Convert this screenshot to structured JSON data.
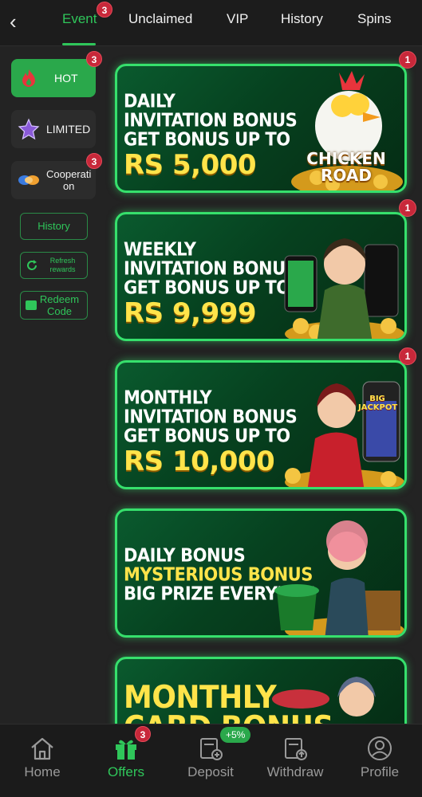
{
  "tabs": [
    {
      "label": "Event",
      "active": true,
      "badge": "3"
    },
    {
      "label": "Unclaimed"
    },
    {
      "label": "VIP"
    },
    {
      "label": "History"
    },
    {
      "label": "Spins"
    }
  ],
  "sidebar": {
    "items": [
      {
        "label": "HOT",
        "badge": "3",
        "icon": "flame-icon"
      },
      {
        "label": "LIMITED",
        "icon": "star-icon"
      },
      {
        "label": "Cooperati\non",
        "badge": "3",
        "icon": "handshake-icon"
      }
    ],
    "history_label": "History",
    "refresh_label": "Refresh\nrewards",
    "redeem_label": "Redeem\nCode"
  },
  "cards": [
    {
      "line1": "DAILY",
      "line2": "INVITATION BONUS",
      "line3": "GET BONUS UP TO",
      "amount": "RS 5,000",
      "badge": "1",
      "art_text": "CHICKEN ROAD"
    },
    {
      "line1": "WEEKLY",
      "line2": "INVITATION BONUS",
      "line3": "GET BONUS UP TO",
      "amount": "RS 9,999",
      "badge": "1"
    },
    {
      "line1": "MONTHLY",
      "line2": "INVITATION BONUS",
      "line3": "GET BONUS UP TO",
      "amount": "RS 10,000",
      "badge": "1",
      "art_text": "BIG JACKPOT"
    },
    {
      "line1": "DAILY BONUS",
      "line2": "MYSTERIOUS BONUS",
      "line3": "BIG PRIZE EVERYDAY"
    },
    {
      "line1": "MONTHLY",
      "line2": "CARD BONUS"
    }
  ],
  "bottom_nav": [
    {
      "label": "Home",
      "icon": "home-icon"
    },
    {
      "label": "Offers",
      "icon": "gift-icon",
      "active": true,
      "badge": "3"
    },
    {
      "label": "Deposit",
      "icon": "deposit-icon",
      "badge": "+5%"
    },
    {
      "label": "Withdraw",
      "icon": "withdraw-icon"
    },
    {
      "label": "Profile",
      "icon": "profile-icon"
    }
  ],
  "colors": {
    "accent": "#2fc65a",
    "badge": "#c8283a",
    "card_border": "#36e06c",
    "amount": "#ffe44a"
  }
}
